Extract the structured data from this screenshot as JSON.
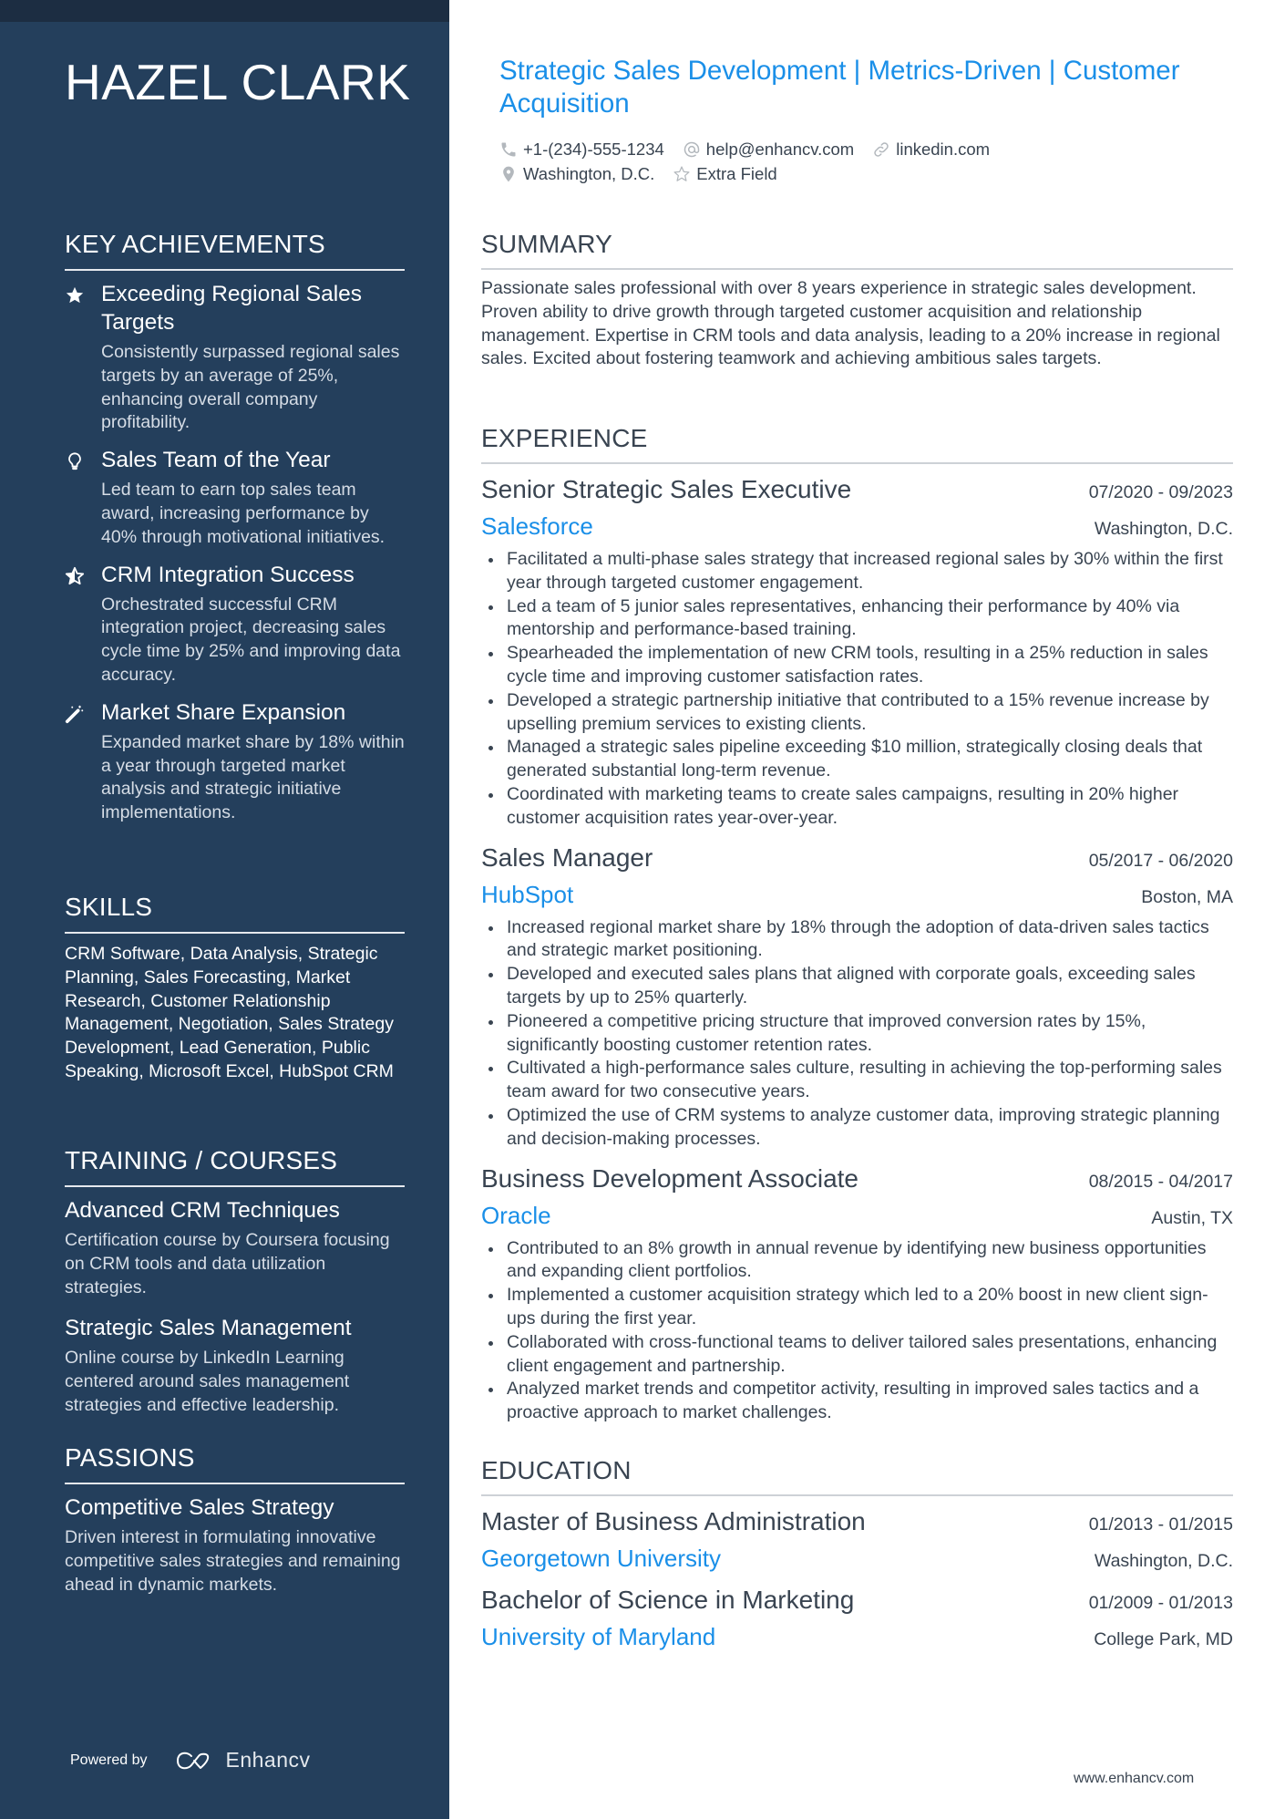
{
  "sidebar": {
    "name": "HAZEL CLARK",
    "achievements": {
      "heading": "KEY ACHIEVEMENTS",
      "items": [
        {
          "icon": "star-icon",
          "title": "Exceeding Regional Sales Targets",
          "desc": "Consistently surpassed regional sales targets by an average of 25%, enhancing overall company profitability."
        },
        {
          "icon": "lightbulb-icon",
          "title": "Sales Team of the Year",
          "desc": "Led team to earn top sales team award, increasing performance by 40% through motivational initiatives."
        },
        {
          "icon": "half-star-icon",
          "title": "CRM Integration Success",
          "desc": "Orchestrated successful CRM integration project, decreasing sales cycle time by 25% and improving data accuracy."
        },
        {
          "icon": "magic-wand-icon",
          "title": "Market Share Expansion",
          "desc": "Expanded market share by 18% within a year through targeted market analysis and strategic initiative implementations."
        }
      ]
    },
    "skills": {
      "heading": "SKILLS",
      "text": "CRM Software, Data Analysis, Strategic Planning, Sales Forecasting, Market Research, Customer Relationship Management, Negotiation, Sales Strategy Development, Lead Generation, Public Speaking, Microsoft Excel, HubSpot CRM"
    },
    "training": {
      "heading": "TRAINING / COURSES",
      "items": [
        {
          "title": "Advanced CRM Techniques",
          "desc": "Certification course by Coursera focusing on CRM tools and data utilization strategies."
        },
        {
          "title": "Strategic Sales Management",
          "desc": "Online course by LinkedIn Learning centered around sales management strategies and effective leadership."
        }
      ]
    },
    "passions": {
      "heading": "PASSIONS",
      "items": [
        {
          "title": "Competitive Sales Strategy",
          "desc": "Driven interest in formulating innovative competitive sales strategies and remaining ahead in dynamic markets."
        }
      ]
    },
    "powered_by": {
      "label": "Powered by",
      "brand": "Enhancv"
    }
  },
  "header": {
    "headline": "Strategic Sales Development | Metrics-Driven | Customer Acquisition",
    "contacts": {
      "phone": "+1-(234)-555-1234",
      "email": "help@enhancv.com",
      "link": "linkedin.com",
      "location": "Washington, D.C.",
      "extra": "Extra Field"
    }
  },
  "summary": {
    "heading": "SUMMARY",
    "text": "Passionate sales professional with over 8 years experience in strategic sales development. Proven ability to drive growth through targeted customer acquisition and relationship management. Expertise in CRM tools and data analysis, leading to a 20% increase in regional sales. Excited about fostering teamwork and achieving ambitious sales targets."
  },
  "experience": {
    "heading": "EXPERIENCE",
    "jobs": [
      {
        "title": "Senior Strategic Sales Executive",
        "dates": "07/2020 - 09/2023",
        "company": "Salesforce",
        "location": "Washington, D.C.",
        "bullets": [
          "Facilitated a multi-phase sales strategy that increased regional sales by 30% within the first year through targeted customer engagement.",
          "Led a team of 5 junior sales representatives, enhancing their performance by 40% via mentorship and performance-based training.",
          "Spearheaded the implementation of new CRM tools, resulting in a 25% reduction in sales cycle time and improving customer satisfaction rates.",
          "Developed a strategic partnership initiative that contributed to a 15% revenue increase by upselling premium services to existing clients.",
          "Managed a strategic sales pipeline exceeding $10 million, strategically closing deals that generated substantial long-term revenue.",
          "Coordinated with marketing teams to create sales campaigns, resulting in 20% higher customer acquisition rates year-over-year."
        ]
      },
      {
        "title": "Sales Manager",
        "dates": "05/2017 - 06/2020",
        "company": "HubSpot",
        "location": "Boston, MA",
        "bullets": [
          "Increased regional market share by 18% through the adoption of data-driven sales tactics and strategic market positioning.",
          "Developed and executed sales plans that aligned with corporate goals, exceeding sales targets by up to 25% quarterly.",
          "Pioneered a competitive pricing structure that improved conversion rates by 15%, significantly boosting customer retention rates.",
          "Cultivated a high-performance sales culture, resulting in achieving the top-performing sales team award for two consecutive years.",
          "Optimized the use of CRM systems to analyze customer data, improving strategic planning and decision-making processes."
        ]
      },
      {
        "title": "Business Development Associate",
        "dates": "08/2015 - 04/2017",
        "company": "Oracle",
        "location": "Austin, TX",
        "bullets": [
          "Contributed to an 8% growth in annual revenue by identifying new business opportunities and expanding client portfolios.",
          "Implemented a customer acquisition strategy which led to a 20% boost in new client sign-ups during the first year.",
          "Collaborated with cross-functional teams to deliver tailored sales presentations, enhancing client engagement and partnership.",
          "Analyzed market trends and competitor activity, resulting in improved sales tactics and a proactive approach to market challenges."
        ]
      }
    ]
  },
  "education": {
    "heading": "EDUCATION",
    "items": [
      {
        "degree": "Master of Business Administration",
        "dates": "01/2013 - 01/2015",
        "school": "Georgetown University",
        "location": "Washington, D.C."
      },
      {
        "degree": "Bachelor of Science in Marketing",
        "dates": "01/2009 - 01/2013",
        "school": "University of Maryland",
        "location": "College Park, MD"
      }
    ]
  },
  "footer": {
    "url": "www.enhancv.com"
  },
  "colors": {
    "sidebar_bg": "#243f5c",
    "accent": "#1a8fe8",
    "text": "#394451"
  }
}
